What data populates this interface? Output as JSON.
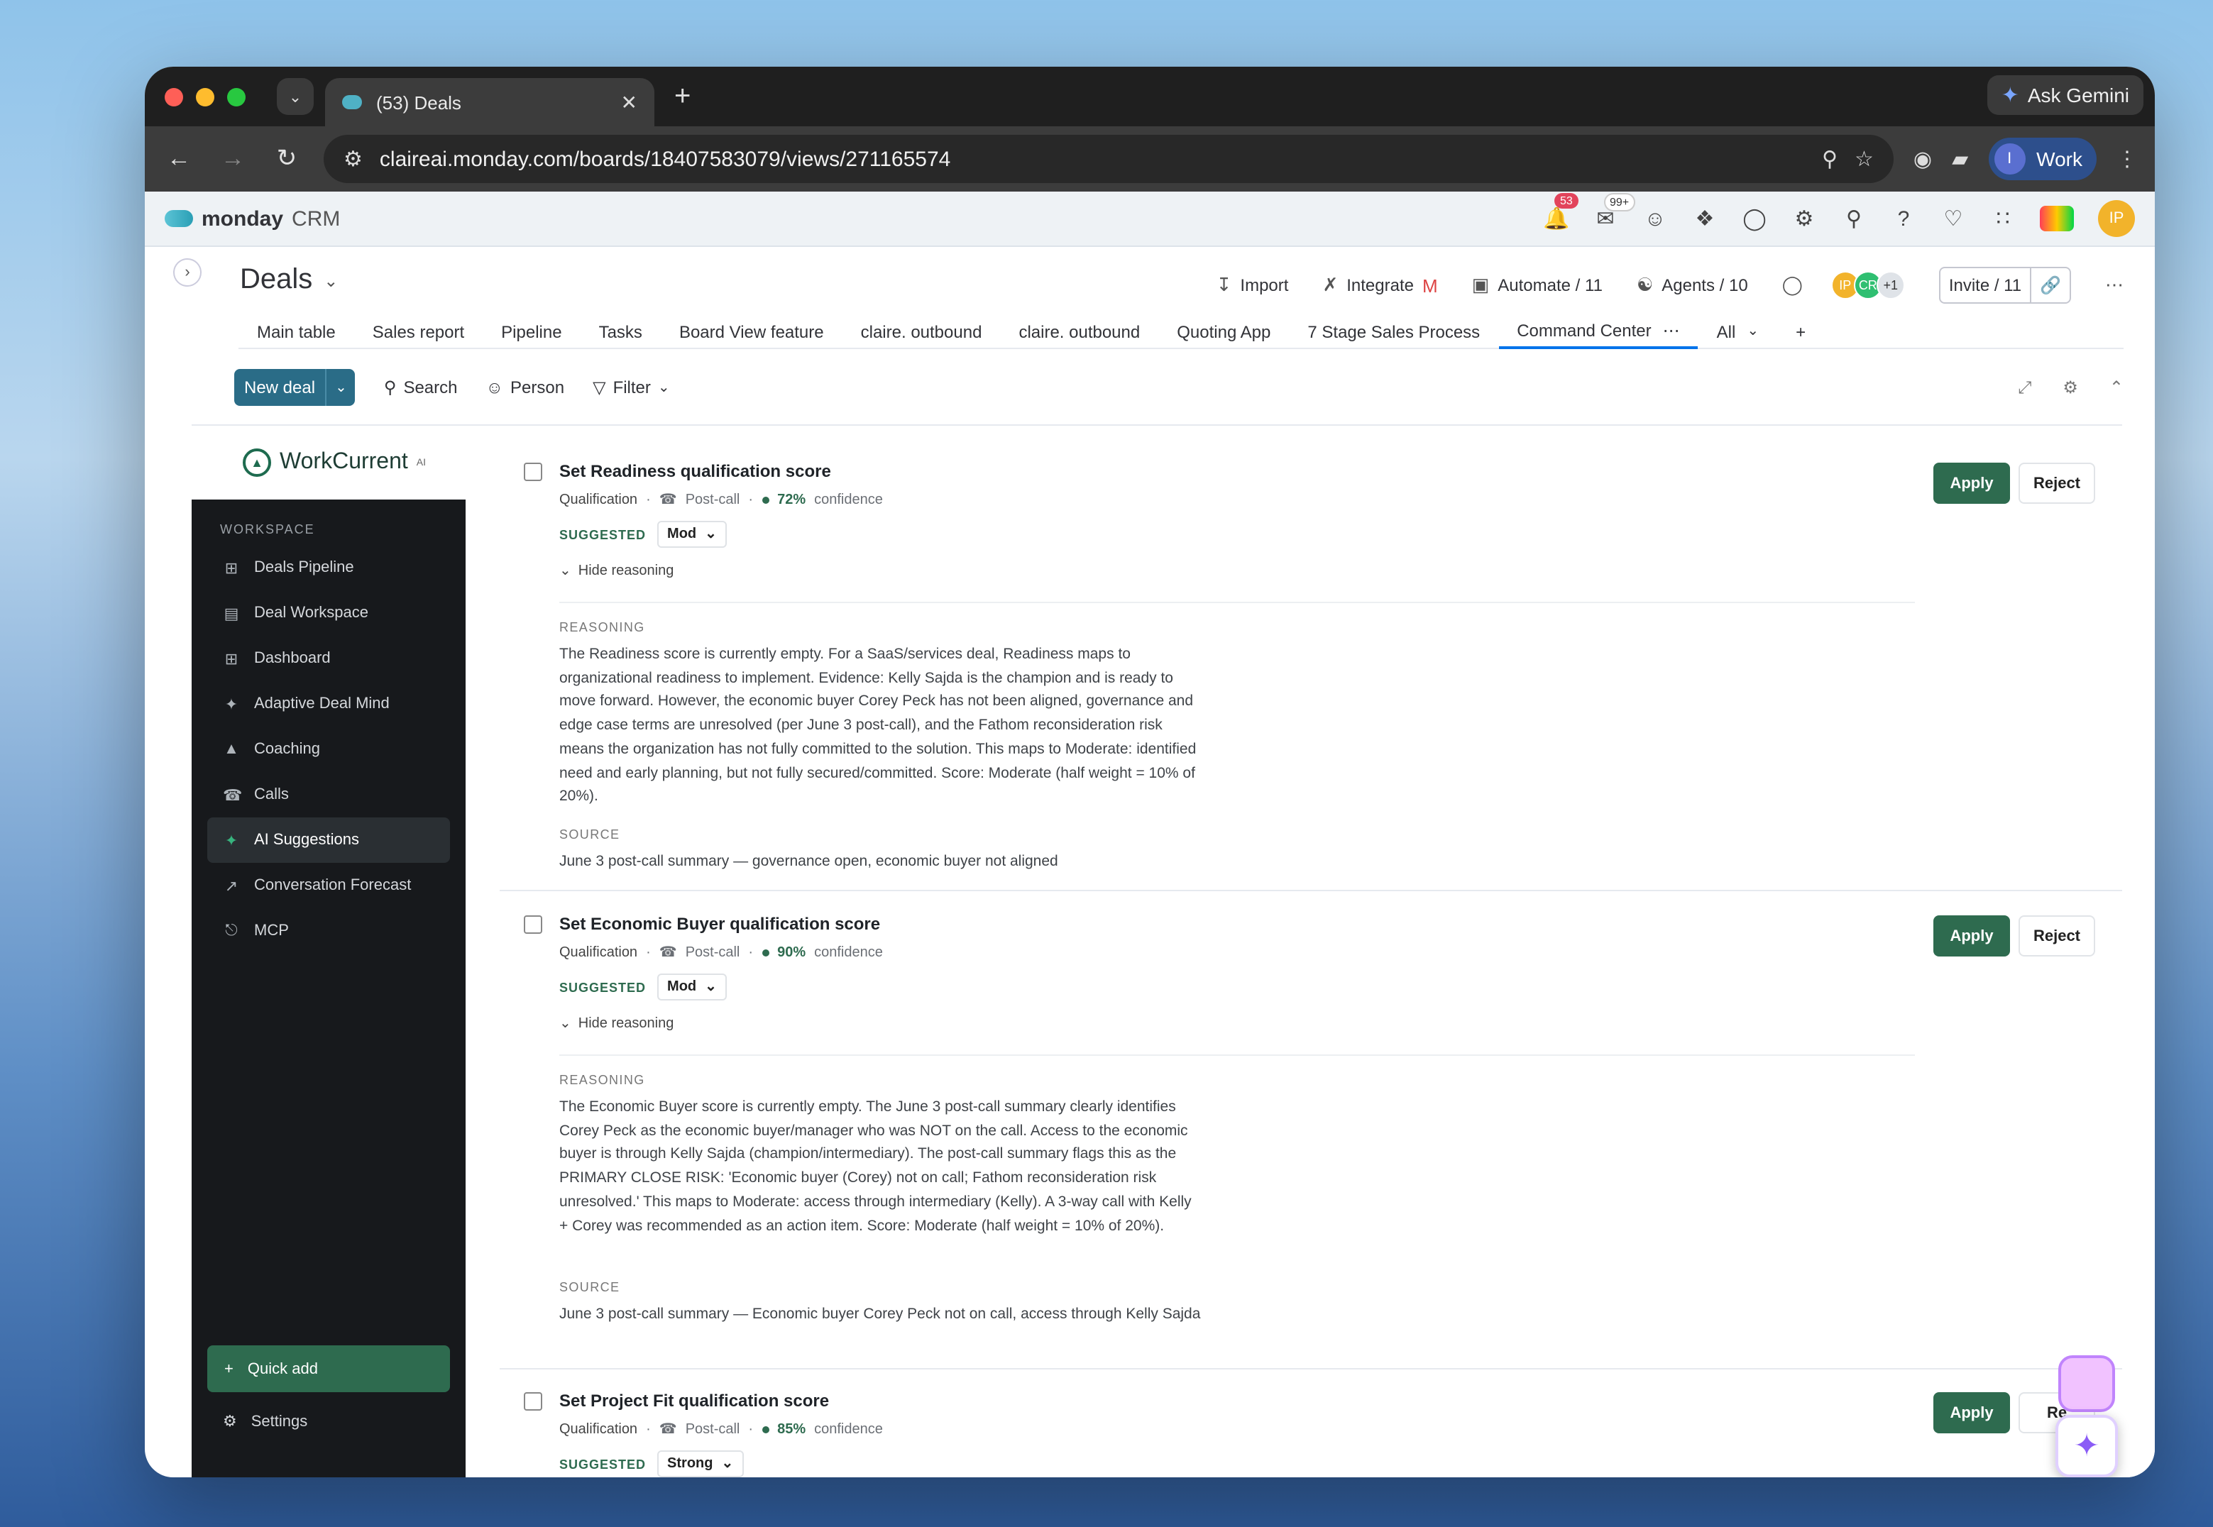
{
  "browser": {
    "tab_title": "(53) Deals",
    "url": "claireai.monday.com/boards/18407583079/views/271165574",
    "ask_gemini": "Ask Gemini",
    "profile": "Work",
    "profile_initial": "I"
  },
  "monday": {
    "logo_word": "monday",
    "logo_suffix": "CRM",
    "notif_count": "53",
    "inbox_count": "99+",
    "user_initials": "IP"
  },
  "board": {
    "title": "Deals",
    "import": "Import",
    "integrate": "Integrate",
    "automate": "Automate / 11",
    "agents": "Agents / 10",
    "avatars": [
      "IP",
      "CR",
      "+1"
    ],
    "invite": "Invite / 11",
    "views": [
      "Main table",
      "Sales report",
      "Pipeline",
      "Tasks",
      "Board View feature",
      "claire. outbound",
      "claire. outbound",
      "Quoting App",
      "7 Stage Sales Process",
      "Command Center"
    ],
    "views_all": "All",
    "new_deal": "New deal",
    "search": "Search",
    "person": "Person",
    "filter": "Filter"
  },
  "sidebar": {
    "brand": "WorkCurrent",
    "brand_suffix": "AI",
    "section": "WORKSPACE",
    "items": [
      {
        "label": "Deals Pipeline",
        "icon": "grid-icon"
      },
      {
        "label": "Deal Workspace",
        "icon": "document-icon"
      },
      {
        "label": "Dashboard",
        "icon": "grid-icon"
      },
      {
        "label": "Adaptive Deal Mind",
        "icon": "sparkle-icon"
      },
      {
        "label": "Coaching",
        "icon": "graduation-cap-icon"
      },
      {
        "label": "Calls",
        "icon": "phone-icon"
      },
      {
        "label": "AI Suggestions",
        "icon": "sparkle-icon"
      },
      {
        "label": "Conversation Forecast",
        "icon": "trend-icon"
      },
      {
        "label": "MCP",
        "icon": "plug-icon"
      }
    ],
    "quick_add": "Quick add",
    "settings": "Settings"
  },
  "suggestions": [
    {
      "title": "Set Readiness qualification score",
      "category": "Qualification",
      "source_type": "Post-call",
      "confidence": "72%",
      "confidence_label": "confidence",
      "suggested_label": "SUGGESTED",
      "suggested_value": "Mod",
      "toggle": "Hide reasoning",
      "reasoning_label": "REASONING",
      "reasoning": "The Readiness score is currently empty. For a SaaS/services deal, Readiness maps to organizational readiness to implement. Evidence: Kelly Sajda is the champion and is ready to move forward. However, the economic buyer Corey Peck has not been aligned, governance and edge case terms are unresolved (per June 3 post-call), and the Fathom reconsideration risk means the organization has not fully committed to the solution. This maps to Moderate: identified need and early planning, but not fully secured/committed. Score: Moderate (half weight = 10% of 20%).",
      "source_label": "SOURCE",
      "source": "June 3 post-call summary — governance open, economic buyer not aligned",
      "apply": "Apply",
      "reject": "Reject"
    },
    {
      "title": "Set Economic Buyer qualification score",
      "category": "Qualification",
      "source_type": "Post-call",
      "confidence": "90%",
      "confidence_label": "confidence",
      "suggested_label": "SUGGESTED",
      "suggested_value": "Mod",
      "toggle": "Hide reasoning",
      "reasoning_label": "REASONING",
      "reasoning": "The Economic Buyer score is currently empty. The June 3 post-call summary clearly identifies Corey Peck as the economic buyer/manager who was NOT on the call. Access to the economic buyer is through Kelly Sajda (champion/intermediary). The post-call summary flags this as the PRIMARY CLOSE RISK: 'Economic buyer (Corey) not on call; Fathom reconsideration risk unresolved.' This maps to Moderate: access through intermediary (Kelly). A 3-way call with Kelly + Corey was recommended as an action item. Score: Moderate (half weight = 10% of 20%).",
      "source_label": "SOURCE",
      "source": "June 3 post-call summary — Economic buyer Corey Peck not on call, access through Kelly Sajda",
      "apply": "Apply",
      "reject": "Reject"
    },
    {
      "title": "Set Project Fit qualification score",
      "category": "Qualification",
      "source_type": "Post-call",
      "confidence": "85%",
      "confidence_label": "confidence",
      "suggested_label": "SUGGESTED",
      "suggested_value": "Strong",
      "apply": "Apply",
      "reject": "Re"
    }
  ]
}
